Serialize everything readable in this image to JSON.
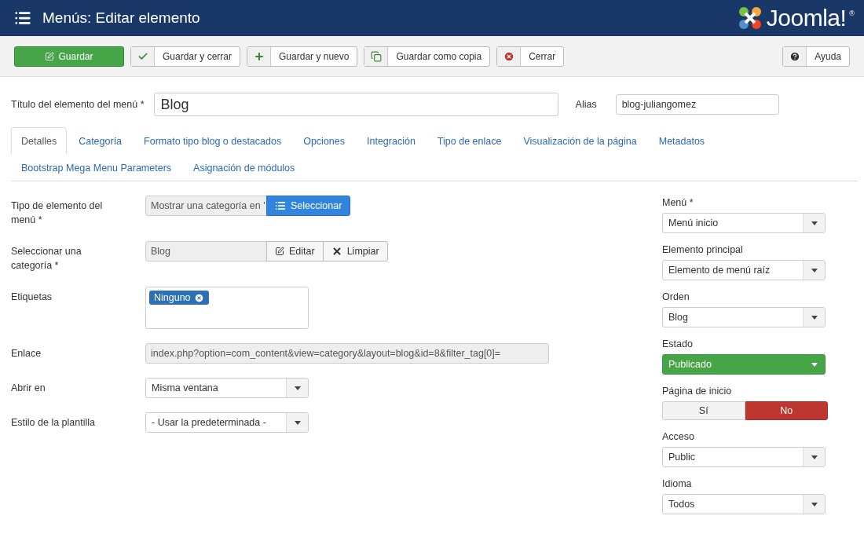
{
  "header": {
    "title": "Menús: Editar elemento",
    "logo": {
      "text": "Joomla!",
      "mark": "®"
    }
  },
  "toolbar": {
    "buttons": [
      {
        "kind": "primary",
        "label": "Guardar"
      },
      {
        "kind": "default",
        "label": "Guardar y cerrar"
      },
      {
        "kind": "default",
        "label": "Guardar y nuevo"
      },
      {
        "kind": "default",
        "label": "Guardar como copia"
      },
      {
        "kind": "default",
        "label": "Cerrar"
      }
    ],
    "help": {
      "label": "Ayuda"
    }
  },
  "title_field": {
    "label": "Título del elemento del menú *",
    "value": "Blog"
  },
  "alias_field": {
    "label": "Alias",
    "value": "blog-juliangomez"
  },
  "tabs": [
    {
      "label": "Detalles",
      "selected": true
    },
    {
      "label": "Categoría",
      "selected": false
    },
    {
      "label": "Formato tipo blog o destacados",
      "selected": false
    },
    {
      "label": "Opciones",
      "selected": false
    },
    {
      "label": "Integración",
      "selected": false
    },
    {
      "label": "Tipo de enlace",
      "selected": false
    },
    {
      "label": "Visualización de la página",
      "selected": false
    },
    {
      "label": "Metadatos",
      "selected": false
    },
    {
      "label": "Bootstrap Mega Menu Parameters",
      "selected": false
    },
    {
      "label": "Asignación de módulos",
      "selected": false
    }
  ],
  "left_fields": [
    {
      "kind": "picker",
      "label": "Tipo de elemento del menú *",
      "value": "Mostrar una categoría en '",
      "buttons": [
        {
          "kind": "primary",
          "label": "Seleccionar"
        }
      ]
    },
    {
      "kind": "picker",
      "label": "Seleccionar una categoría *",
      "value": "Blog",
      "buttons": [
        {
          "kind": "default",
          "label": "Editar"
        },
        {
          "kind": "default",
          "label": "Limpiar"
        }
      ]
    },
    {
      "kind": "tags",
      "label": "Etiquetas",
      "tags": [
        "Ninguno"
      ]
    },
    {
      "kind": "readonly",
      "label": "Enlace",
      "value": "index.php?option=com_content&view=category&layout=blog&id=8&filter_tag[0]="
    },
    {
      "kind": "select",
      "label": "Abrir en",
      "value": "Misma ventana"
    },
    {
      "kind": "select",
      "label": "Estilo de la plantilla",
      "value": "- Usar la predeterminada -"
    }
  ],
  "right_fields": [
    {
      "kind": "select",
      "label": "Menú *",
      "value": "Menú inicio"
    },
    {
      "kind": "select",
      "label": "Elemento principal",
      "value": "Elemento de menú raíz"
    },
    {
      "kind": "select",
      "label": "Orden",
      "value": "Blog"
    },
    {
      "kind": "status",
      "label": "Estado",
      "value": "Publicado"
    },
    {
      "kind": "toggle",
      "label": "Página de inicio",
      "options": [
        {
          "label": "Sí",
          "selected": false
        },
        {
          "label": "No",
          "selected": true
        }
      ]
    },
    {
      "kind": "select",
      "label": "Acceso",
      "value": "Public"
    },
    {
      "kind": "select",
      "label": "Idioma",
      "value": "Todos"
    }
  ]
}
